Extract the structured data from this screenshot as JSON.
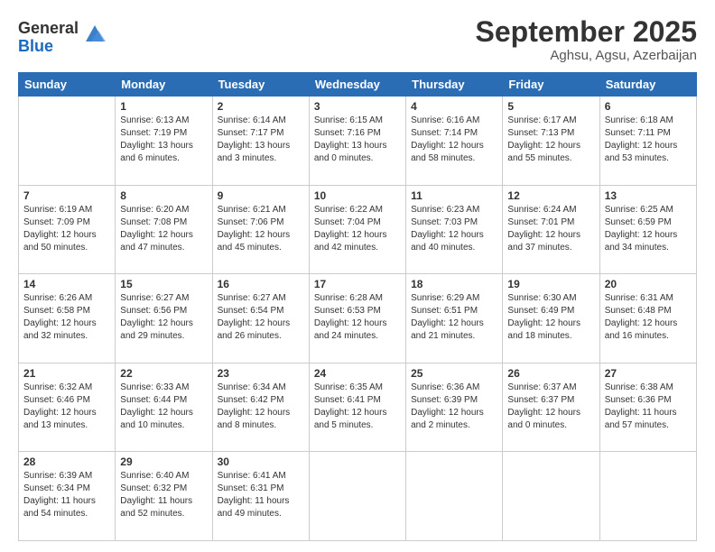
{
  "logo": {
    "general": "General",
    "blue": "Blue"
  },
  "header": {
    "month_year": "September 2025",
    "location": "Aghsu, Agsu, Azerbaijan"
  },
  "weekdays": [
    "Sunday",
    "Monday",
    "Tuesday",
    "Wednesday",
    "Thursday",
    "Friday",
    "Saturday"
  ],
  "weeks": [
    [
      {
        "day": "",
        "sunrise": "",
        "sunset": "",
        "daylight": ""
      },
      {
        "day": "1",
        "sunrise": "Sunrise: 6:13 AM",
        "sunset": "Sunset: 7:19 PM",
        "daylight": "Daylight: 13 hours and 6 minutes."
      },
      {
        "day": "2",
        "sunrise": "Sunrise: 6:14 AM",
        "sunset": "Sunset: 7:17 PM",
        "daylight": "Daylight: 13 hours and 3 minutes."
      },
      {
        "day": "3",
        "sunrise": "Sunrise: 6:15 AM",
        "sunset": "Sunset: 7:16 PM",
        "daylight": "Daylight: 13 hours and 0 minutes."
      },
      {
        "day": "4",
        "sunrise": "Sunrise: 6:16 AM",
        "sunset": "Sunset: 7:14 PM",
        "daylight": "Daylight: 12 hours and 58 minutes."
      },
      {
        "day": "5",
        "sunrise": "Sunrise: 6:17 AM",
        "sunset": "Sunset: 7:13 PM",
        "daylight": "Daylight: 12 hours and 55 minutes."
      },
      {
        "day": "6",
        "sunrise": "Sunrise: 6:18 AM",
        "sunset": "Sunset: 7:11 PM",
        "daylight": "Daylight: 12 hours and 53 minutes."
      }
    ],
    [
      {
        "day": "7",
        "sunrise": "Sunrise: 6:19 AM",
        "sunset": "Sunset: 7:09 PM",
        "daylight": "Daylight: 12 hours and 50 minutes."
      },
      {
        "day": "8",
        "sunrise": "Sunrise: 6:20 AM",
        "sunset": "Sunset: 7:08 PM",
        "daylight": "Daylight: 12 hours and 47 minutes."
      },
      {
        "day": "9",
        "sunrise": "Sunrise: 6:21 AM",
        "sunset": "Sunset: 7:06 PM",
        "daylight": "Daylight: 12 hours and 45 minutes."
      },
      {
        "day": "10",
        "sunrise": "Sunrise: 6:22 AM",
        "sunset": "Sunset: 7:04 PM",
        "daylight": "Daylight: 12 hours and 42 minutes."
      },
      {
        "day": "11",
        "sunrise": "Sunrise: 6:23 AM",
        "sunset": "Sunset: 7:03 PM",
        "daylight": "Daylight: 12 hours and 40 minutes."
      },
      {
        "day": "12",
        "sunrise": "Sunrise: 6:24 AM",
        "sunset": "Sunset: 7:01 PM",
        "daylight": "Daylight: 12 hours and 37 minutes."
      },
      {
        "day": "13",
        "sunrise": "Sunrise: 6:25 AM",
        "sunset": "Sunset: 6:59 PM",
        "daylight": "Daylight: 12 hours and 34 minutes."
      }
    ],
    [
      {
        "day": "14",
        "sunrise": "Sunrise: 6:26 AM",
        "sunset": "Sunset: 6:58 PM",
        "daylight": "Daylight: 12 hours and 32 minutes."
      },
      {
        "day": "15",
        "sunrise": "Sunrise: 6:27 AM",
        "sunset": "Sunset: 6:56 PM",
        "daylight": "Daylight: 12 hours and 29 minutes."
      },
      {
        "day": "16",
        "sunrise": "Sunrise: 6:27 AM",
        "sunset": "Sunset: 6:54 PM",
        "daylight": "Daylight: 12 hours and 26 minutes."
      },
      {
        "day": "17",
        "sunrise": "Sunrise: 6:28 AM",
        "sunset": "Sunset: 6:53 PM",
        "daylight": "Daylight: 12 hours and 24 minutes."
      },
      {
        "day": "18",
        "sunrise": "Sunrise: 6:29 AM",
        "sunset": "Sunset: 6:51 PM",
        "daylight": "Daylight: 12 hours and 21 minutes."
      },
      {
        "day": "19",
        "sunrise": "Sunrise: 6:30 AM",
        "sunset": "Sunset: 6:49 PM",
        "daylight": "Daylight: 12 hours and 18 minutes."
      },
      {
        "day": "20",
        "sunrise": "Sunrise: 6:31 AM",
        "sunset": "Sunset: 6:48 PM",
        "daylight": "Daylight: 12 hours and 16 minutes."
      }
    ],
    [
      {
        "day": "21",
        "sunrise": "Sunrise: 6:32 AM",
        "sunset": "Sunset: 6:46 PM",
        "daylight": "Daylight: 12 hours and 13 minutes."
      },
      {
        "day": "22",
        "sunrise": "Sunrise: 6:33 AM",
        "sunset": "Sunset: 6:44 PM",
        "daylight": "Daylight: 12 hours and 10 minutes."
      },
      {
        "day": "23",
        "sunrise": "Sunrise: 6:34 AM",
        "sunset": "Sunset: 6:42 PM",
        "daylight": "Daylight: 12 hours and 8 minutes."
      },
      {
        "day": "24",
        "sunrise": "Sunrise: 6:35 AM",
        "sunset": "Sunset: 6:41 PM",
        "daylight": "Daylight: 12 hours and 5 minutes."
      },
      {
        "day": "25",
        "sunrise": "Sunrise: 6:36 AM",
        "sunset": "Sunset: 6:39 PM",
        "daylight": "Daylight: 12 hours and 2 minutes."
      },
      {
        "day": "26",
        "sunrise": "Sunrise: 6:37 AM",
        "sunset": "Sunset: 6:37 PM",
        "daylight": "Daylight: 12 hours and 0 minutes."
      },
      {
        "day": "27",
        "sunrise": "Sunrise: 6:38 AM",
        "sunset": "Sunset: 6:36 PM",
        "daylight": "Daylight: 11 hours and 57 minutes."
      }
    ],
    [
      {
        "day": "28",
        "sunrise": "Sunrise: 6:39 AM",
        "sunset": "Sunset: 6:34 PM",
        "daylight": "Daylight: 11 hours and 54 minutes."
      },
      {
        "day": "29",
        "sunrise": "Sunrise: 6:40 AM",
        "sunset": "Sunset: 6:32 PM",
        "daylight": "Daylight: 11 hours and 52 minutes."
      },
      {
        "day": "30",
        "sunrise": "Sunrise: 6:41 AM",
        "sunset": "Sunset: 6:31 PM",
        "daylight": "Daylight: 11 hours and 49 minutes."
      },
      {
        "day": "",
        "sunrise": "",
        "sunset": "",
        "daylight": ""
      },
      {
        "day": "",
        "sunrise": "",
        "sunset": "",
        "daylight": ""
      },
      {
        "day": "",
        "sunrise": "",
        "sunset": "",
        "daylight": ""
      },
      {
        "day": "",
        "sunrise": "",
        "sunset": "",
        "daylight": ""
      }
    ]
  ]
}
